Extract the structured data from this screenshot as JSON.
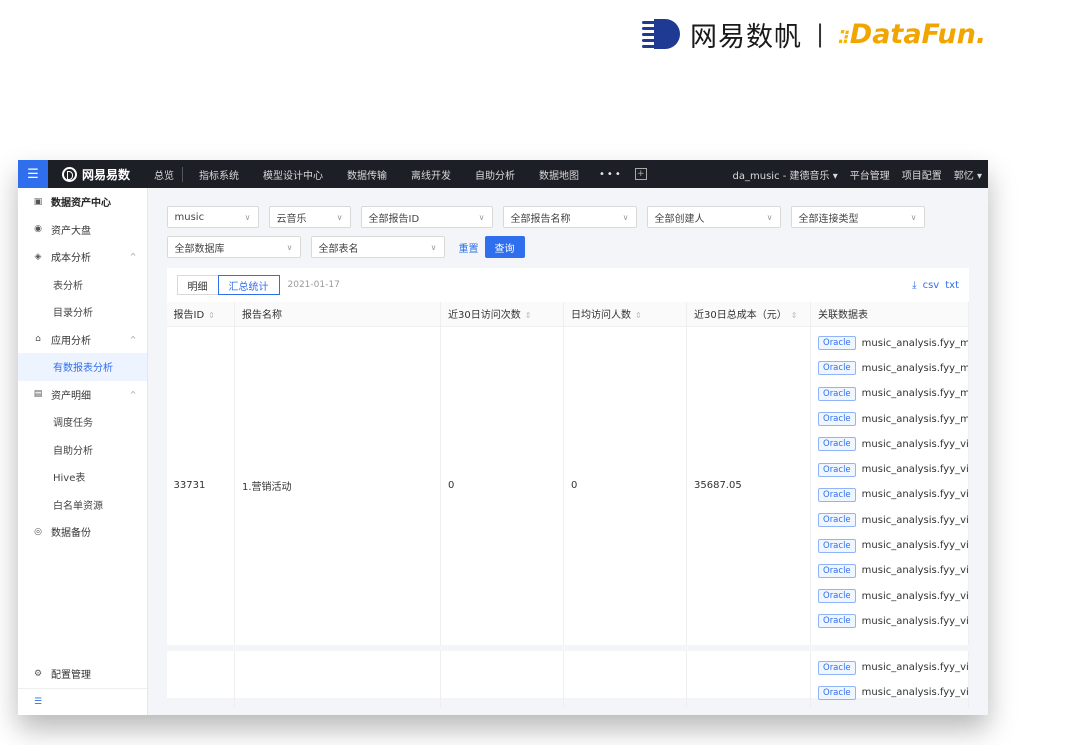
{
  "branding": {
    "netease_name": "网易数帆",
    "separator": "|",
    "datafun": "DataFun."
  },
  "topnav": {
    "logo_text": "网易易数",
    "items": [
      "总览",
      "指标系统",
      "模型设计中心",
      "数据传输",
      "离线开发",
      "自助分析",
      "数据地图"
    ],
    "more": "•••",
    "project": "da_music - 建德音乐",
    "project_arrow": "▾",
    "platform": "平台管理",
    "project_config": "项目配置",
    "user": "郭忆",
    "user_arrow": "▾"
  },
  "sidebar": {
    "items": [
      {
        "label": "数据资产中心",
        "kind": "head",
        "icon": "asset-center-icon"
      },
      {
        "label": "资产大盘",
        "kind": "group",
        "icon": "dashboard-icon"
      },
      {
        "label": "成本分析",
        "kind": "group",
        "icon": "cost-icon",
        "expandable": true
      },
      {
        "label": "表分析",
        "kind": "sub"
      },
      {
        "label": "目录分析",
        "kind": "sub"
      },
      {
        "label": "应用分析",
        "kind": "group",
        "icon": "app-icon",
        "expandable": true
      },
      {
        "label": "有数报表分析",
        "kind": "sub",
        "active": true
      },
      {
        "label": "资产明细",
        "kind": "group",
        "icon": "detail-icon",
        "expandable": true
      },
      {
        "label": "调度任务",
        "kind": "sub"
      },
      {
        "label": "自助分析",
        "kind": "sub"
      },
      {
        "label": "Hive表",
        "kind": "sub"
      },
      {
        "label": "白名单资源",
        "kind": "sub"
      },
      {
        "label": "数据备份",
        "kind": "group",
        "icon": "backup-icon"
      }
    ],
    "config": "配置管理"
  },
  "filters": {
    "music": "music",
    "cloud_music": "云音乐",
    "report_id": "全部报告ID",
    "report_name": "全部报告名称",
    "creator": "全部创建人",
    "conn_type": "全部连接类型",
    "database": "全部数据库",
    "table_name": "全部表名",
    "reset": "重置",
    "query": "查询"
  },
  "panel": {
    "tab_detail": "明细",
    "tab_summary": "汇总统计",
    "date": "2021-01-17",
    "csv": "csv",
    "txt": "txt"
  },
  "table": {
    "headers": [
      "报告ID",
      "报告名称",
      "近30日访问次数",
      "日均访问人数",
      "近30日总成本（元）",
      "关联数据表"
    ],
    "row1": {
      "id": "33731",
      "name": "1.营销活动",
      "visits": "0",
      "daily_users": "0",
      "cost": "35687.05",
      "tables": [
        "music_analysis.fyy_marke",
        "music_analysis.fyy_marke",
        "music_analysis.fyy_marke",
        "music_analysis.fyy_marke",
        "music_analysis.fyy_vipact",
        "music_analysis.fyy_vipact",
        "music_analysis.fyy_vipact",
        "music_analysis.fyy_vipact",
        "music_analysis.fyy_vipact",
        "music_analysis.fyy_vipact",
        "music_analysis.fyy_vipact",
        "music_analysis.fyy_vipact"
      ]
    },
    "row2": {
      "tables": [
        "music_analysis.fyy_vipact",
        "music_analysis.fyy_vipact"
      ]
    },
    "tag": "Oracle"
  }
}
